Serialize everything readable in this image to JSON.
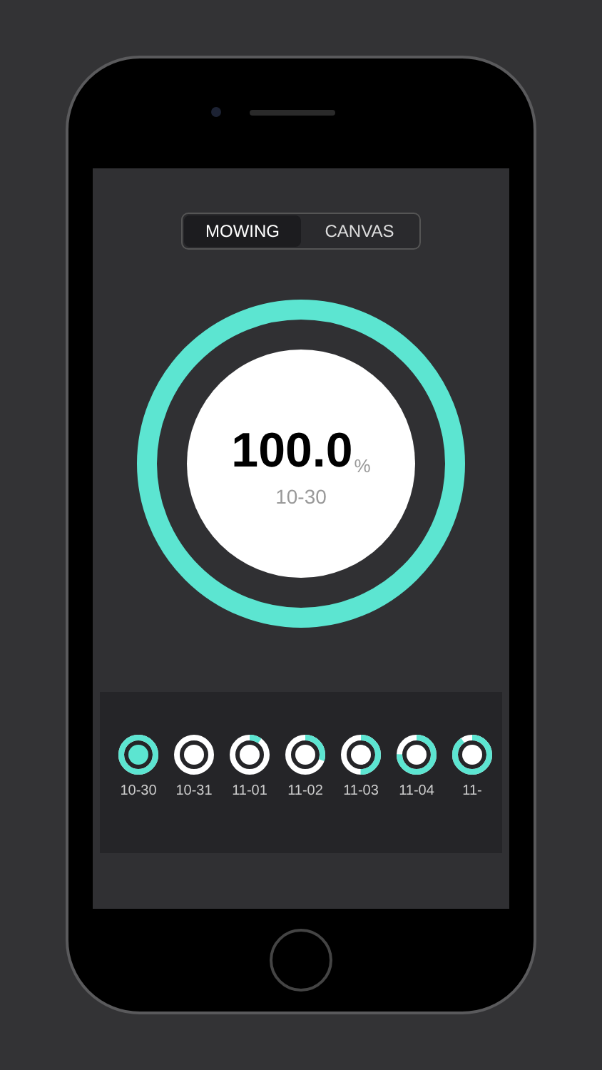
{
  "tabs": [
    {
      "label": "MOWING",
      "selected": true
    },
    {
      "label": "CANVAS",
      "selected": false
    }
  ],
  "gauge": {
    "value": "100.0",
    "unit": "%",
    "date": "10-30",
    "level": 1
  },
  "days": [
    {
      "label": "10-30",
      "level": 1,
      "selected": true
    },
    {
      "label": "10-31",
      "level": 0,
      "selected": false
    },
    {
      "label": "11-01",
      "level": 0.1,
      "selected": false
    },
    {
      "label": "11-02",
      "level": 0.3,
      "selected": false
    },
    {
      "label": "11-03",
      "level": 0.5,
      "selected": false
    },
    {
      "label": "11-04",
      "level": 0.75,
      "selected": false
    },
    {
      "label": "11-",
      "level": 0.9,
      "selected": false
    }
  ]
}
